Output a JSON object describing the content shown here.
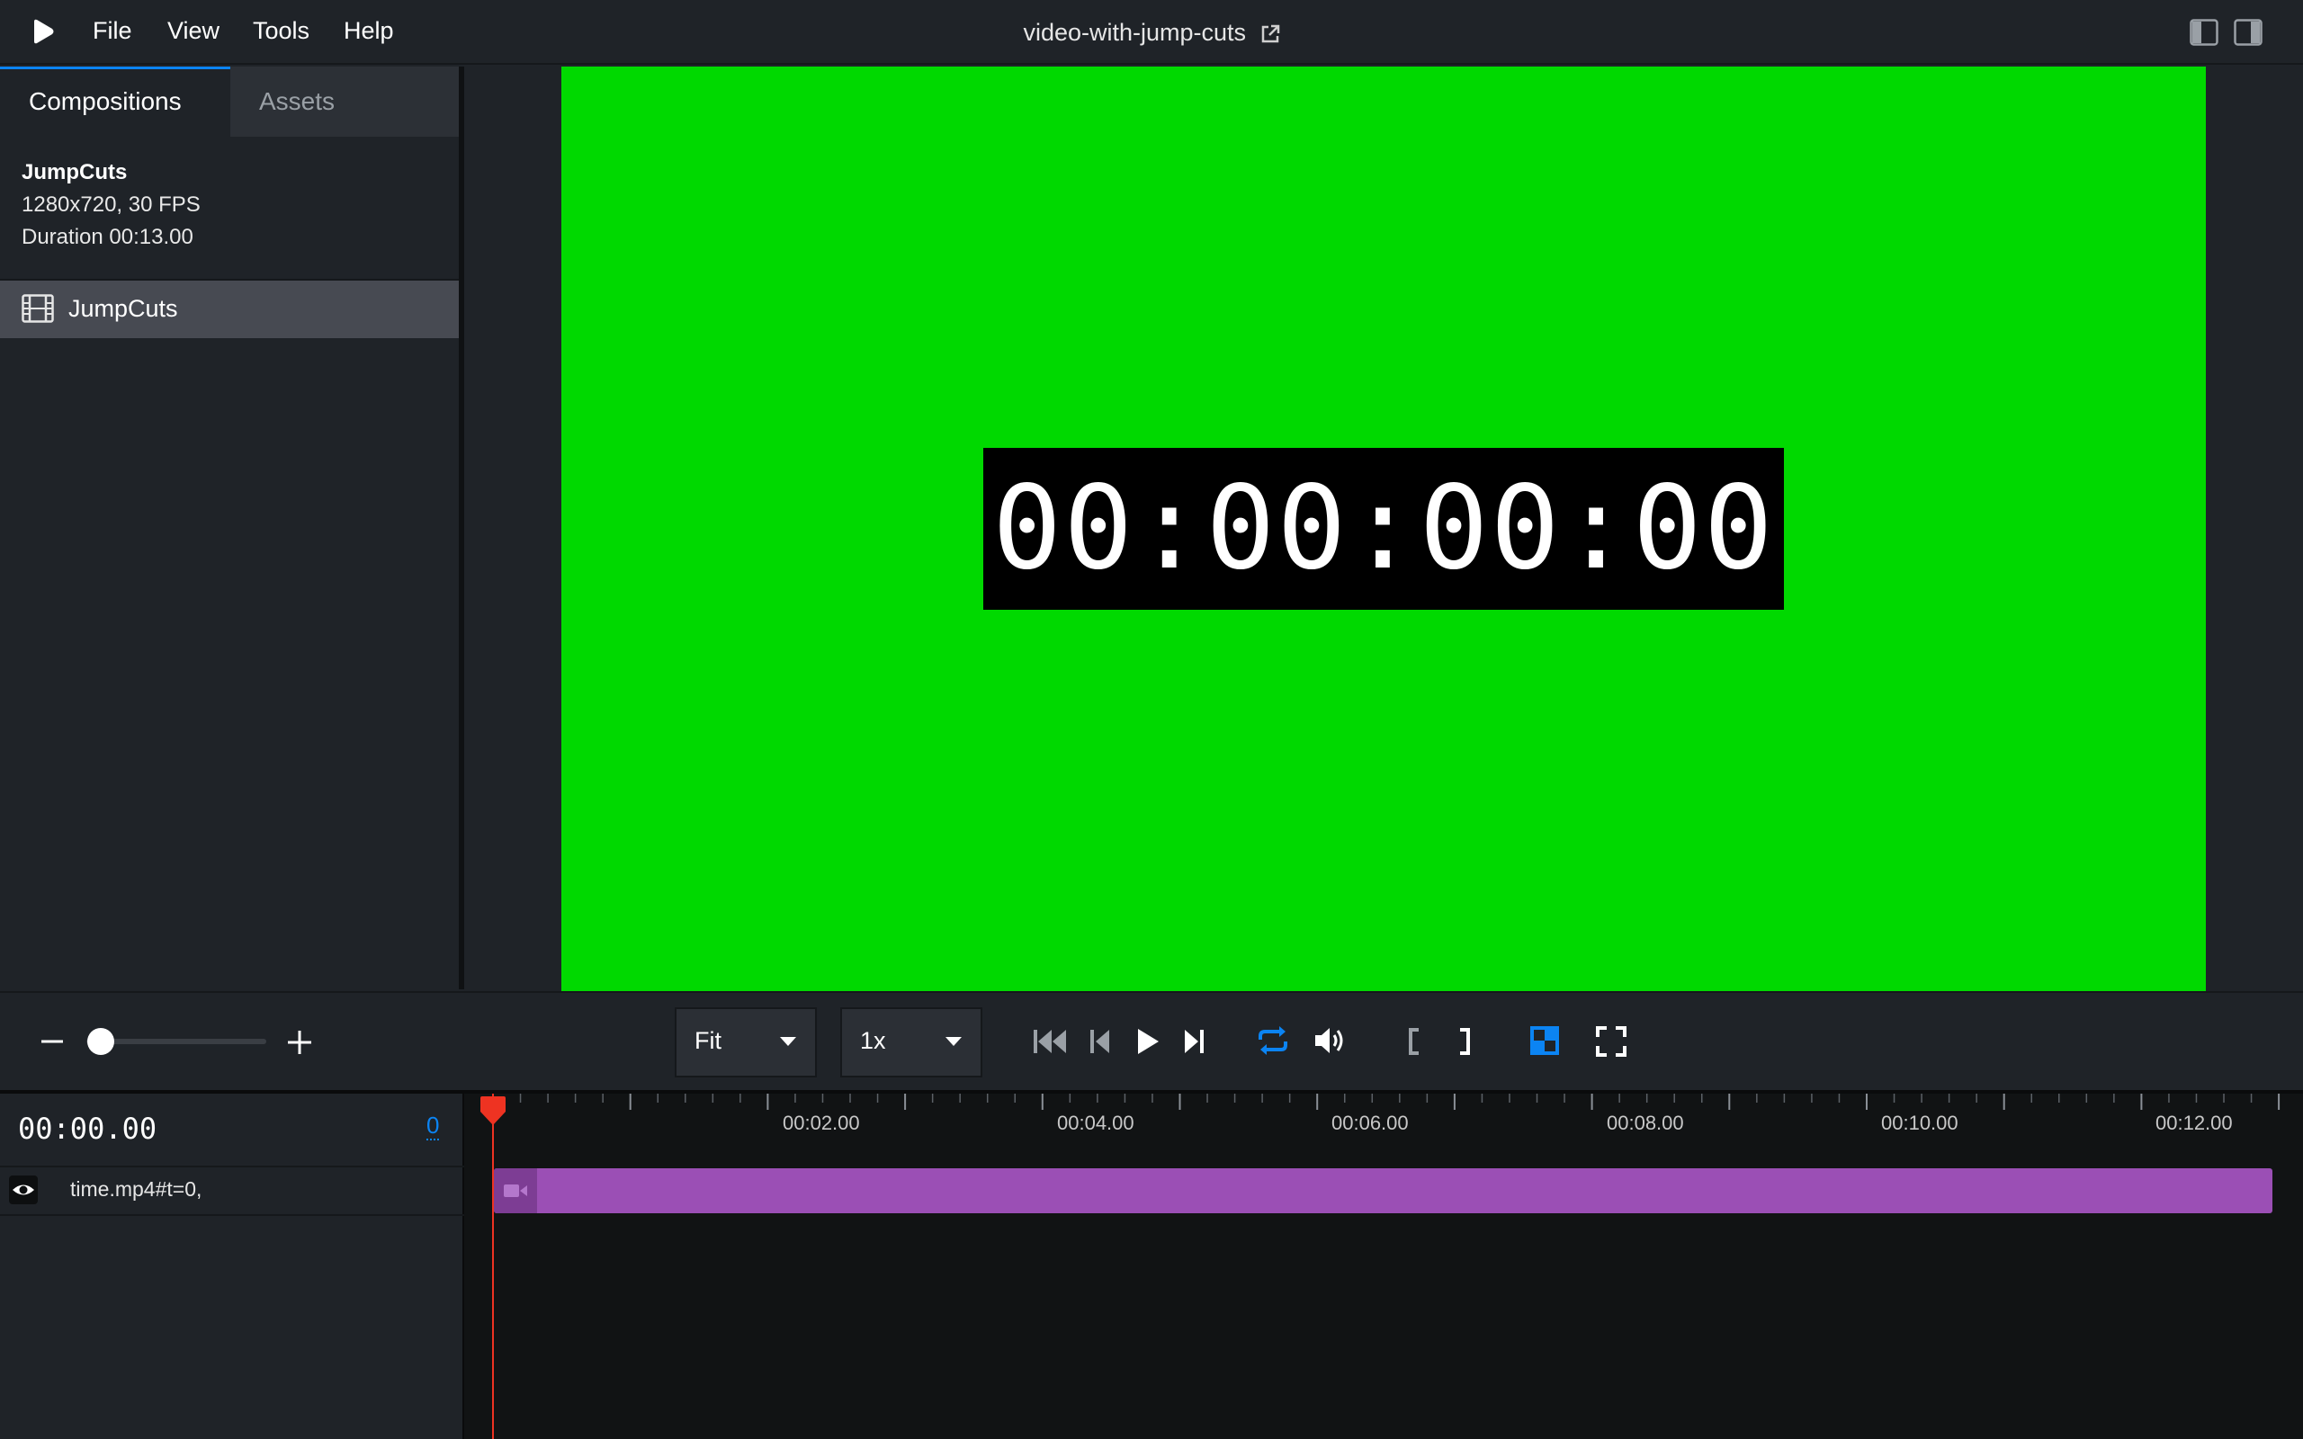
{
  "menu": {
    "items": [
      {
        "label": "File"
      },
      {
        "label": "View"
      },
      {
        "label": "Tools"
      },
      {
        "label": "Help"
      }
    ],
    "project_title": "video-with-jump-cuts"
  },
  "sidebar": {
    "tabs": [
      {
        "label": "Compositions",
        "active": true
      },
      {
        "label": "Assets",
        "active": false
      }
    ],
    "composition_info": {
      "name": "JumpCuts",
      "resolution_fps": "1280x720, 30 FPS",
      "duration": "Duration 00:13.00"
    },
    "compositions": [
      {
        "label": "JumpCuts",
        "icon": "film-icon",
        "selected": true
      }
    ]
  },
  "canvas": {
    "background_color": "#00d900",
    "timecode": "00:00:00:00"
  },
  "controls": {
    "zoom_level": 0.0,
    "size_select": "Fit",
    "rate_select": "1x",
    "accent_color": "#0b84f3"
  },
  "timeline": {
    "current_time": "00:00.00",
    "current_frame": "0",
    "ticks": [
      "00:02.00",
      "00:04.00",
      "00:06.00",
      "00:08.00",
      "00:10.00",
      "00:12.00"
    ],
    "track": {
      "label": "time.mp4#t=0,",
      "clip_color": "#9b4fb5"
    },
    "playhead_color": "#ee3322"
  }
}
